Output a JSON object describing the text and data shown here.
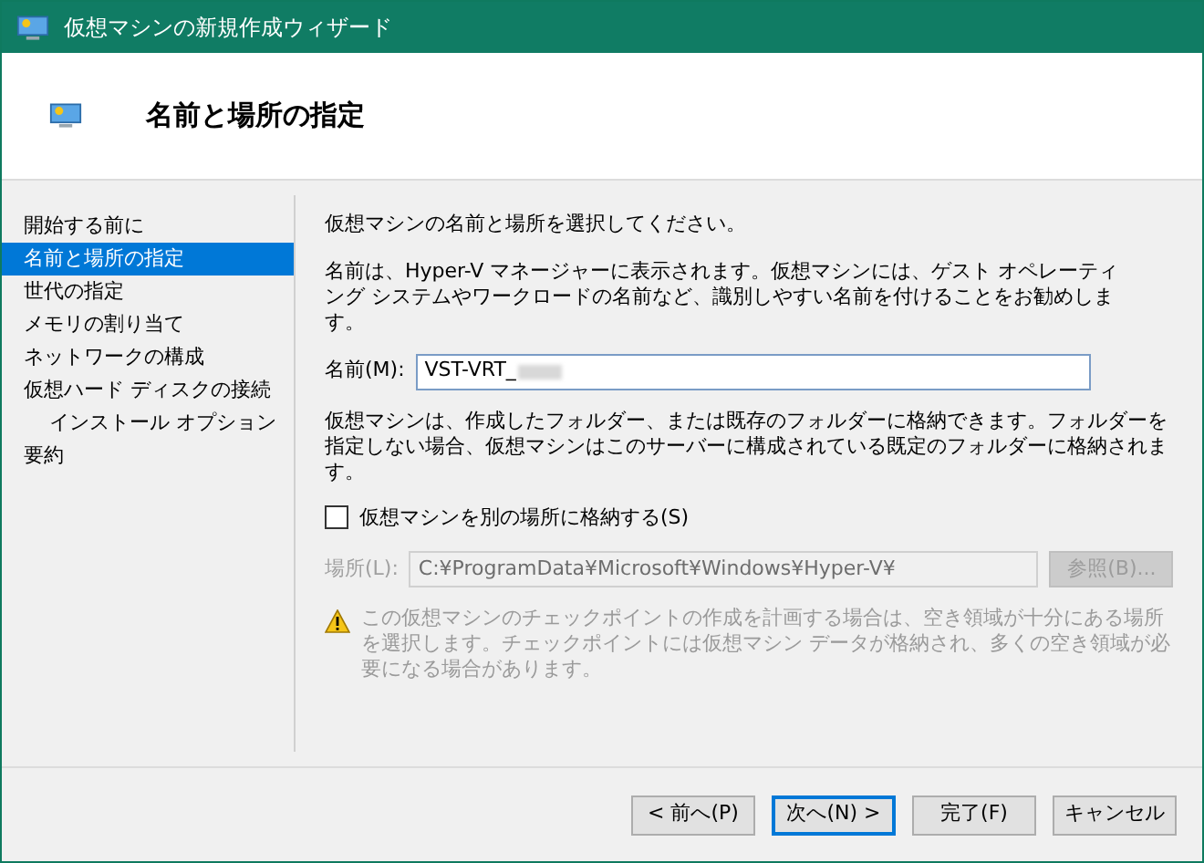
{
  "window": {
    "title": "仮想マシンの新規作成ウィザード"
  },
  "header": {
    "title": "名前と場所の指定"
  },
  "steps": [
    {
      "label": "開始する前に",
      "selected": false
    },
    {
      "label": "名前と場所の指定",
      "selected": true
    },
    {
      "label": "世代の指定",
      "selected": false
    },
    {
      "label": "メモリの割り当て",
      "selected": false
    },
    {
      "label": "ネットワークの構成",
      "selected": false
    },
    {
      "label": "仮想ハード ディスクの接続",
      "selected": false,
      "children": [
        {
          "label": "インストール オプション",
          "selected": false
        }
      ]
    },
    {
      "label": "要約",
      "selected": false
    }
  ],
  "content": {
    "intro": "仮想マシンの名前と場所を選択してください。",
    "name_help": "名前は、Hyper-V マネージャーに表示されます。仮想マシンには、ゲスト オペレーティング システムやワークロードの名前など、識別しやすい名前を付けることをお勧めします。",
    "name_field": {
      "label": "名前(M):",
      "value": "VST-VRT_"
    },
    "location_help": "仮想マシンは、作成したフォルダー、または既存のフォルダーに格納できます。フォルダーを指定しない場合、仮想マシンはこのサーバーに構成されている既定のフォルダーに格納されます。",
    "store_elsewhere": {
      "label": "仮想マシンを別の場所に格納する(S)",
      "checked": false
    },
    "location_field": {
      "label": "場所(L):",
      "value": "C:¥ProgramData¥Microsoft¥Windows¥Hyper-V¥",
      "disabled": true
    },
    "browse_button": {
      "label": "参照(B)...",
      "disabled": true
    },
    "warning": "この仮想マシンのチェックポイントの作成を計画する場合は、空き領域が十分にある場所を選択します。チェックポイントには仮想マシン データが格納され、多くの空き領域が必要になる場合があります。"
  },
  "buttons": [
    {
      "label": "< 前へ(P)",
      "selected": false
    },
    {
      "label": "次へ(N) >",
      "selected": true
    },
    {
      "label": "完了(F)",
      "selected": false
    },
    {
      "label": "キャンセル",
      "selected": false
    }
  ]
}
